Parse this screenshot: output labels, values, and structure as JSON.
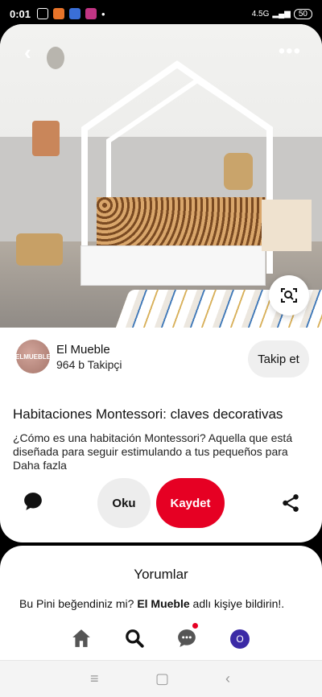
{
  "status_bar": {
    "time": "0:01",
    "network": "4.5G",
    "battery": "50"
  },
  "pin": {
    "image_alt": "Kids house bed room",
    "author": {
      "avatar_text": "ELMUEBLE",
      "name": "El Mueble",
      "followers": "964 b Takipçi"
    },
    "follow_label": "Takip et",
    "title": "Habitaciones Montessori: claves decorativas",
    "description": "¿Cómo es una habitación Montessori? Aquella que está diseñada para seguir estimulando a tus pequeños para",
    "more_label": "Daha fazla",
    "read_label": "Oku",
    "save_label": "Kaydet"
  },
  "comments": {
    "title": "Yorumlar",
    "prompt_prefix": "Bu Pini beğendiniz mi? ",
    "prompt_author": "El Mueble",
    "prompt_suffix": " adlı kişiye bildirin!."
  },
  "nav": {
    "profile_initial": "O"
  },
  "colors": {
    "save": "#e60023",
    "profile": "#3b2aa6"
  }
}
